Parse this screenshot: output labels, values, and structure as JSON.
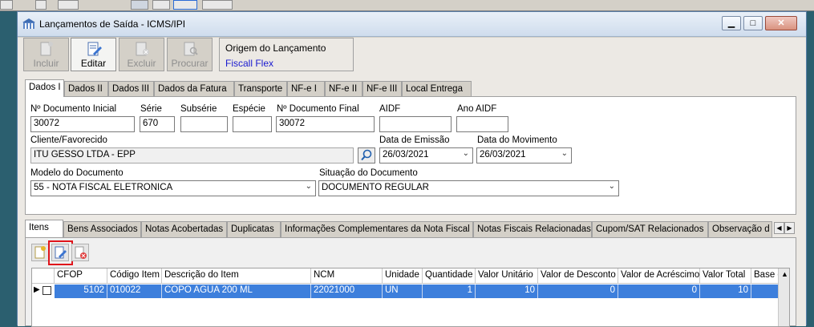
{
  "window": {
    "title": "Lançamentos de Saída - ICMS/IPI"
  },
  "toolbar": {
    "incluir": "Incluir",
    "editar": "Editar",
    "excluir": "Excluir",
    "procurar": "Procurar"
  },
  "origem": {
    "label": "Origem do Lançamento",
    "value": "Fiscall Flex"
  },
  "tabs": [
    "Dados I",
    "Dados II",
    "Dados III",
    "Dados da Fatura",
    "Transporte",
    "NF-e I",
    "NF-e II",
    "NF-e III",
    "Local Entrega"
  ],
  "form": {
    "doc_inicial_label": "Nº Documento Inicial",
    "doc_inicial": "30072",
    "serie_label": "Série",
    "serie": "670",
    "subserie_label": "Subsérie",
    "subserie": "",
    "especie_label": "Espécie",
    "especie": "",
    "doc_final_label": "Nº Documento Final",
    "doc_final": "30072",
    "aidf_label": "AIDF",
    "aidf": "",
    "ano_aidf_label": "Ano AIDF",
    "ano_aidf": "",
    "cliente_label": "Cliente/Favorecido",
    "cliente": "ITU GESSO LTDA - EPP",
    "data_emissao_label": "Data de Emissão",
    "data_emissao": "26/03/2021",
    "data_mov_label": "Data do Movimento",
    "data_mov": "26/03/2021",
    "modelo_label": "Modelo do Documento",
    "modelo": "55 - NOTA FISCAL ELETRONICA",
    "situacao_label": "Situação do Documento",
    "situacao": "DOCUMENTO REGULAR"
  },
  "subtabs": [
    "Itens",
    "Bens Associados",
    "Notas Acobertadas",
    "Duplicatas",
    "Informações Complementares da Nota Fiscal",
    "Notas Fiscais Relacionadas",
    "Cupom/SAT Relacionados",
    "Observação d"
  ],
  "grid": {
    "headers": [
      "CFOP",
      "Código Item",
      "Descrição do Item",
      "NCM",
      "Unidade",
      "Quantidade",
      "Valor Unitário",
      "Valor de Desconto",
      "Valor de Acréscimo",
      "Valor Total",
      "Base c"
    ],
    "rows": [
      [
        "5102",
        "010022",
        "COPO AGUA 200 ML",
        "22021000",
        "UN",
        "1",
        "10",
        "0",
        "0",
        "10",
        ""
      ]
    ]
  },
  "colors": {
    "selection": "#3d7fdc",
    "highlight_box": "#e0141b"
  }
}
